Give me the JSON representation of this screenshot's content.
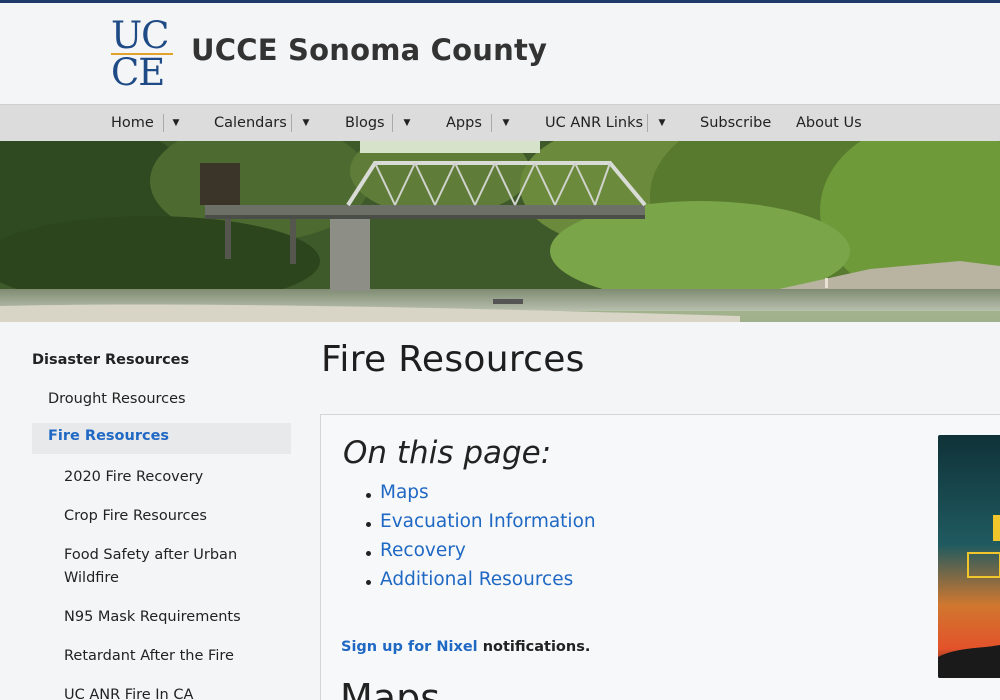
{
  "header": {
    "logo_top": "UC",
    "logo_bottom": "CE",
    "site_title": "UCCE Sonoma County"
  },
  "nav": {
    "items": [
      {
        "label": "Home",
        "has_dropdown": true
      },
      {
        "label": "Calendars",
        "has_dropdown": true
      },
      {
        "label": "Blogs",
        "has_dropdown": true
      },
      {
        "label": "Apps",
        "has_dropdown": true
      },
      {
        "label": "UC ANR Links",
        "has_dropdown": true
      },
      {
        "label": "Subscribe",
        "has_dropdown": false
      },
      {
        "label": "About Us",
        "has_dropdown": false
      }
    ]
  },
  "sidebar": {
    "heading": "Disaster Resources",
    "items": [
      {
        "label": "Drought Resources"
      },
      {
        "label": "Fire Resources",
        "active": true
      },
      {
        "label": "2020 Fire Recovery"
      },
      {
        "label": "Crop Fire Resources"
      },
      {
        "label": "Food Safety after Urban Wildfire"
      },
      {
        "label": "N95 Mask Requirements"
      },
      {
        "label": "Retardant After the Fire"
      },
      {
        "label": "UC ANR Fire In CA"
      }
    ]
  },
  "main": {
    "title": "Fire Resources",
    "on_this_page": "On this page:",
    "toc": [
      "Maps",
      "Evacuation Information",
      "Recovery",
      "Additional Resources"
    ],
    "signup_link": "Sign up for Nixel",
    "signup_rest": " notifications.",
    "next_heading": "Maps"
  },
  "colors": {
    "link": "#1f68c4",
    "brand_navy": "#1e4a86",
    "brand_gold": "#e2a32b",
    "nav_bg": "#dcdcdc"
  }
}
